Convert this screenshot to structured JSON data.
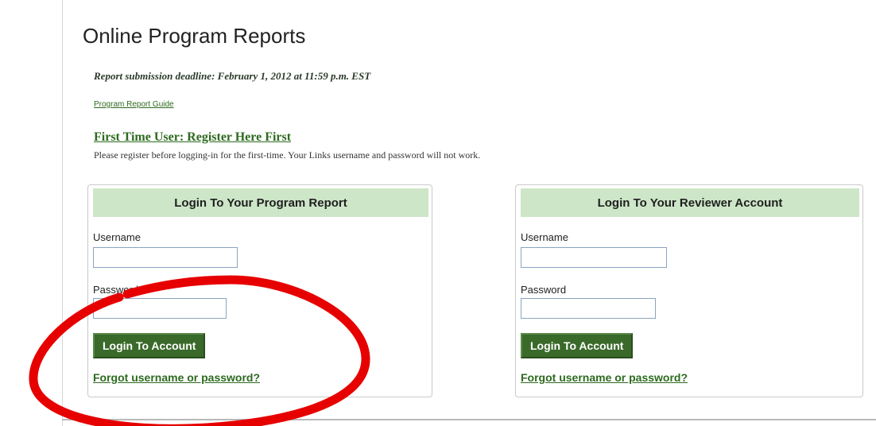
{
  "page": {
    "title": "Online Program Reports",
    "deadline": "Report submission deadline: February 1, 2012 at 11:59 p.m. EST",
    "guide_link": "Program Report Guide",
    "register_link": "First Time User: Register Here First",
    "register_note": "Please register before logging-in for the first-time. Your Links username and password will not work."
  },
  "program_login": {
    "header": "Login To Your Program Report",
    "username_label": "Username",
    "username_value": "",
    "password_label": "Password",
    "password_value": "",
    "button_label": "Login To Account",
    "forgot_link": "Forgot username or password?"
  },
  "reviewer_login": {
    "header": "Login To Your Reviewer Account",
    "username_label": "Username",
    "username_value": "",
    "password_label": "Password",
    "password_value": "",
    "button_label": "Login To Account",
    "forgot_link": "Forgot username or password?"
  },
  "colors": {
    "accent_green": "#2d6a1f",
    "header_green": "#cde6c8",
    "button_green": "#3a6a2a",
    "annotation_red": "#e60000"
  }
}
